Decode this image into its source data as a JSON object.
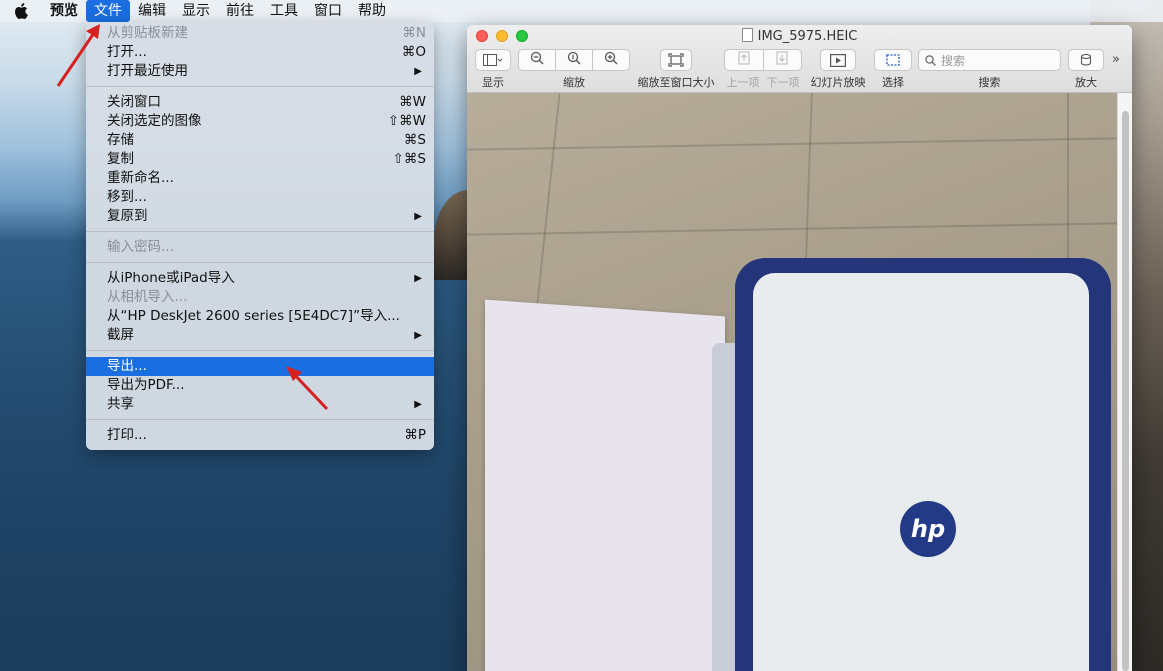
{
  "menubar": {
    "items": [
      {
        "label": "预览"
      },
      {
        "label": "文件"
      },
      {
        "label": "编辑"
      },
      {
        "label": "显示"
      },
      {
        "label": "前往"
      },
      {
        "label": "工具"
      },
      {
        "label": "窗口"
      },
      {
        "label": "帮助"
      }
    ]
  },
  "file_menu": {
    "new_from_clipboard": {
      "label": "从剪贴板新建",
      "shortcut": "⌘N"
    },
    "open": {
      "label": "打开...",
      "shortcut": "⌘O"
    },
    "open_recent": {
      "label": "打开最近使用"
    },
    "close_window": {
      "label": "关闭窗口",
      "shortcut": "⌘W"
    },
    "close_selected": {
      "label": "关闭选定的图像",
      "shortcut": "⇧⌘W"
    },
    "save": {
      "label": "存储",
      "shortcut": "⌘S"
    },
    "duplicate": {
      "label": "复制",
      "shortcut": "⇧⌘S"
    },
    "rename": {
      "label": "重新命名..."
    },
    "move_to": {
      "label": "移到..."
    },
    "revert_to": {
      "label": "复原到"
    },
    "enter_password": {
      "label": "输入密码..."
    },
    "import_iphone": {
      "label": "从iPhone或iPad导入"
    },
    "import_camera": {
      "label": "从相机导入..."
    },
    "import_hp": {
      "label": "从“HP DeskJet 2600 series [5E4DC7]”导入..."
    },
    "screenshot": {
      "label": "截屏"
    },
    "export": {
      "label": "导出..."
    },
    "export_pdf": {
      "label": "导出为PDF..."
    },
    "share": {
      "label": "共享"
    },
    "print": {
      "label": "打印...",
      "shortcut": "⌘P"
    }
  },
  "window": {
    "title": "IMG_5975.HEIC",
    "toolbar": {
      "view_label": "显示",
      "zoom_label": "缩放",
      "zoom_to_fit_label": "缩放至窗口大小",
      "prev_label": "上一项",
      "next_label": "下一项",
      "slideshow_label": "幻灯片放映",
      "select_label": "选择",
      "search_label": "搜索",
      "search_placeholder": "搜索",
      "magnify_label": "放大"
    },
    "photo": {
      "logo_text": "hp"
    }
  },
  "colors": {
    "menu_highlight": "#1a6ee0",
    "annotation_red": "#d42020",
    "printer_blue": "#24357a"
  },
  "icons": {
    "apple": "apple-icon",
    "arrow": "red-annotation-arrow"
  }
}
